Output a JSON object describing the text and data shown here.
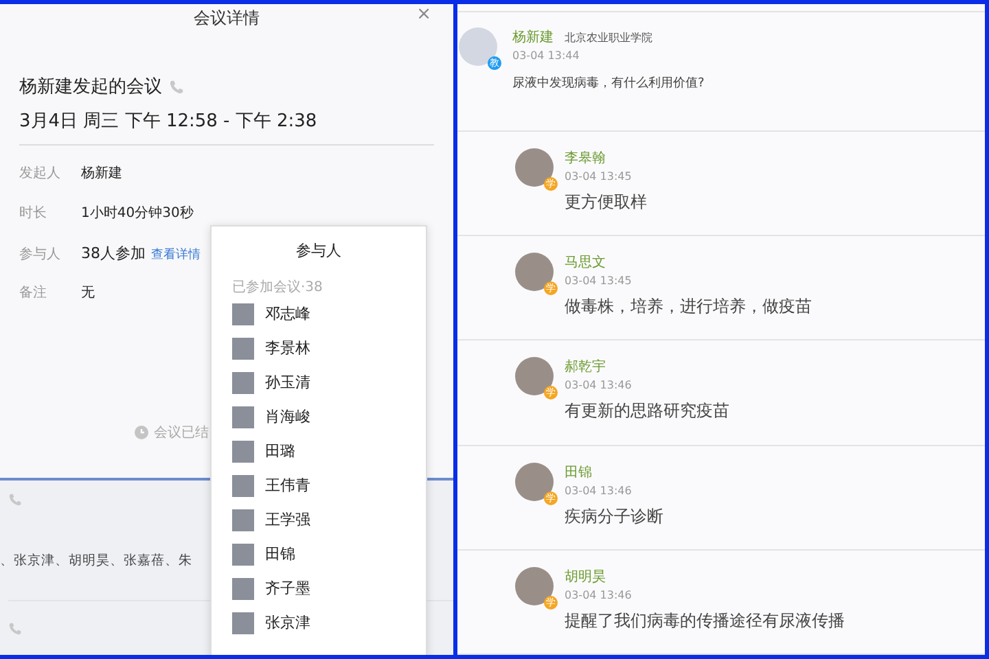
{
  "dialog": {
    "title": "会议详情",
    "close": "×",
    "heading": "杨新建发起的会议",
    "datetime": "3月4日 周三 下午 12:58 - 下午 2:38",
    "fields": [
      {
        "label": "发起人",
        "value": "杨新建"
      },
      {
        "label": "时长",
        "value": "1小时40分钟30秒"
      },
      {
        "label": "参与人",
        "value": "38人参加",
        "link": "查看详情"
      },
      {
        "label": "备注",
        "value": "无"
      }
    ],
    "status": "会议已结"
  },
  "background_list": {
    "names": "、张京津、胡明昊、张嘉蓓、朱"
  },
  "participants_popup": {
    "title": "参与人",
    "subtitle": "已参加会议·38",
    "people": [
      {
        "name": "邓志峰"
      },
      {
        "name": "李景林"
      },
      {
        "name": "孙玉清"
      },
      {
        "name": "肖海峻"
      },
      {
        "name": "田璐"
      },
      {
        "name": "王伟青"
      },
      {
        "name": "王学强"
      },
      {
        "name": "田锦"
      },
      {
        "name": "齐子墨"
      },
      {
        "name": "张京津"
      }
    ]
  },
  "discussion": {
    "post": {
      "author": "杨新建",
      "school": "北京农业职业学院",
      "time": "03-04 13:44",
      "text": "尿液中发现病毒，有什么利用价值?",
      "badge": "教",
      "color": "#1e9bf0"
    },
    "replies": [
      {
        "author": "李皋翰",
        "time": "03-04 13:45",
        "text": "更方便取样",
        "badge": "学",
        "color": "#f5a623"
      },
      {
        "author": "马思文",
        "time": "03-04 13:45",
        "text": "做毒株，培养，进行培养，做疫苗",
        "badge": "学",
        "color": "#f5a623"
      },
      {
        "author": "郝乾宇",
        "time": "03-04 13:46",
        "text": "有更新的思路研究疫苗",
        "badge": "学",
        "color": "#f5a623"
      },
      {
        "author": "田锦",
        "time": "03-04 13:46",
        "text": "疾病分子诊断",
        "badge": "学",
        "color": "#f5a623"
      },
      {
        "author": "胡明昊",
        "time": "03-04 13:46",
        "text": "提醒了我们病毒的传播途径有尿液传播",
        "badge": "学",
        "color": "#f5a623"
      }
    ]
  }
}
